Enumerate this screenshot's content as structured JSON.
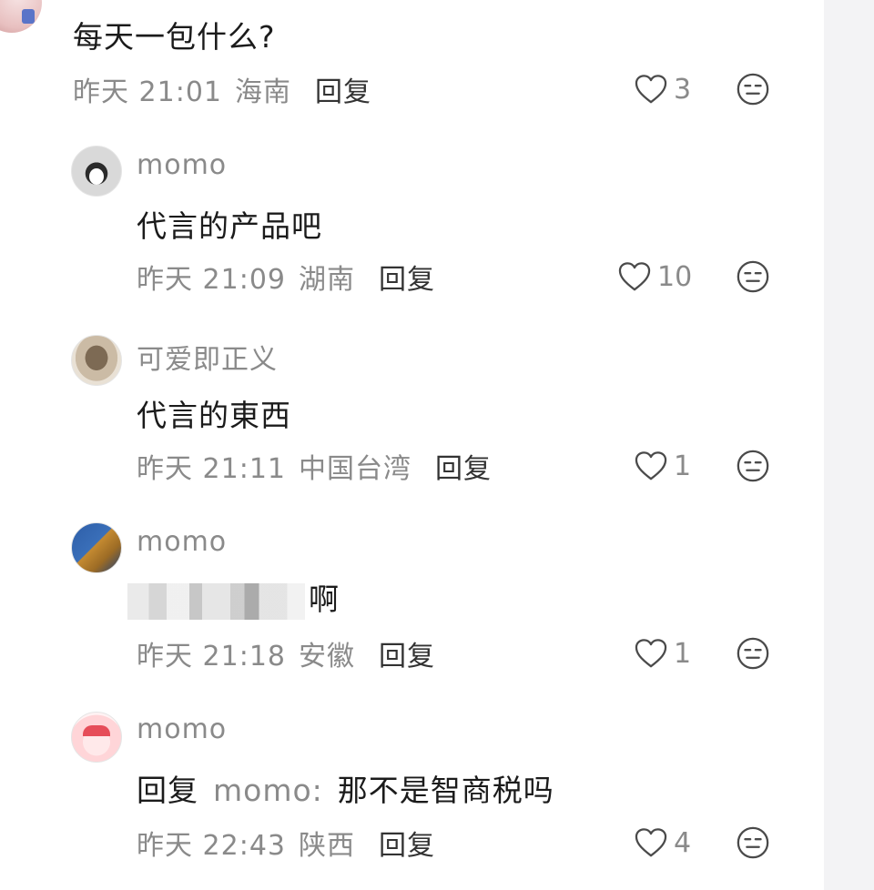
{
  "parent": {
    "text": "每天一包什么?",
    "time": "昨天 21:01",
    "location": "海南",
    "reply_label": "回复",
    "likes": "3"
  },
  "replies": [
    {
      "username": "momo",
      "text": "代言的产品吧",
      "time": "昨天 21:09",
      "location": "湖南",
      "reply_label": "回复",
      "likes": "10"
    },
    {
      "username": "可爱即正义",
      "text": "代言的東西",
      "time": "昨天 21:11",
      "location": "中国台湾",
      "reply_label": "回复",
      "likes": "1"
    },
    {
      "username": "momo",
      "text_suffix": "啊",
      "time": "昨天 21:18",
      "location": "安徽",
      "reply_label": "回复",
      "likes": "1"
    },
    {
      "username": "momo",
      "reply_prefix": "回复",
      "reply_target": "momo:",
      "text": "那不是智商税吗",
      "time": "昨天 22:43",
      "location": "陕西",
      "reply_label": "回复",
      "likes": "4"
    }
  ],
  "colors": {
    "meta_gray": "#8a8a8a",
    "text_dark": "#1b1b1b",
    "side_strip": "#f3f3f5"
  },
  "icons": {
    "like": "heart-outline-icon",
    "emoji": "neutral-face-icon"
  }
}
